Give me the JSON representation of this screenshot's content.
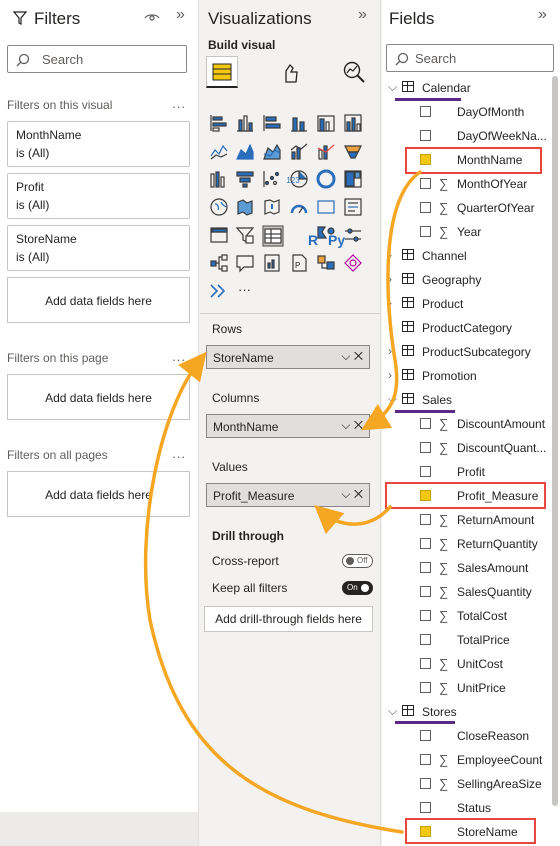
{
  "filters": {
    "title": "Filters",
    "search_placeholder": "Search",
    "on_visual_label": "Filters on this visual",
    "cards": [
      {
        "name": "MonthName",
        "state": "is (All)"
      },
      {
        "name": "Profit",
        "state": "is (All)"
      },
      {
        "name": "StoreName",
        "state": "is (All)"
      }
    ],
    "add_fields": "Add data fields here",
    "on_page_label": "Filters on this page",
    "on_all_label": "Filters on all pages",
    "more": "..."
  },
  "viz": {
    "title": "Visualizations",
    "build_visual": "Build visual",
    "rows_label": "Rows",
    "rows_value": "StoreName",
    "columns_label": "Columns",
    "columns_value": "MonthName",
    "values_label": "Values",
    "values_value": "Profit_Measure",
    "drill_label": "Drill through",
    "cross_report": "Cross-report",
    "cross_state": "Off",
    "keep_filters": "Keep all filters",
    "keep_state": "On",
    "add_drill": "Add drill-through fields here",
    "more_icon": "···",
    "r_icon": "R",
    "py_icon": "Py",
    "num_icon": "123"
  },
  "fields": {
    "title": "Fields",
    "search_placeholder": "Search",
    "rows": [
      {
        "type": "table",
        "name": "Calendar",
        "expanded": true
      },
      {
        "type": "field",
        "name": "DayOfMonth",
        "sigma": false,
        "checked": false
      },
      {
        "type": "field",
        "name": "DayOfWeekNa...",
        "sigma": false,
        "checked": false
      },
      {
        "type": "field",
        "name": "MonthName",
        "sigma": false,
        "checked": true
      },
      {
        "type": "field",
        "name": "MonthOfYear",
        "sigma": true,
        "checked": false
      },
      {
        "type": "field",
        "name": "QuarterOfYear",
        "sigma": true,
        "checked": false
      },
      {
        "type": "field",
        "name": "Year",
        "sigma": true,
        "checked": false
      },
      {
        "type": "table",
        "name": "Channel",
        "expanded": false
      },
      {
        "type": "table",
        "name": "Geography",
        "expanded": false
      },
      {
        "type": "table",
        "name": "Product",
        "expanded": false
      },
      {
        "type": "table",
        "name": "ProductCategory",
        "expanded": false
      },
      {
        "type": "table",
        "name": "ProductSubcategory",
        "expanded": false
      },
      {
        "type": "table",
        "name": "Promotion",
        "expanded": false
      },
      {
        "type": "table",
        "name": "Sales",
        "expanded": true
      },
      {
        "type": "field",
        "name": "DiscountAmount",
        "sigma": true,
        "checked": false
      },
      {
        "type": "field",
        "name": "DiscountQuant...",
        "sigma": true,
        "checked": false
      },
      {
        "type": "field",
        "name": "Profit",
        "sigma": false,
        "checked": false
      },
      {
        "type": "field",
        "name": "Profit_Measure",
        "sigma": false,
        "checked": true
      },
      {
        "type": "field",
        "name": "ReturnAmount",
        "sigma": true,
        "checked": false
      },
      {
        "type": "field",
        "name": "ReturnQuantity",
        "sigma": true,
        "checked": false
      },
      {
        "type": "field",
        "name": "SalesAmount",
        "sigma": true,
        "checked": false
      },
      {
        "type": "field",
        "name": "SalesQuantity",
        "sigma": true,
        "checked": false
      },
      {
        "type": "field",
        "name": "TotalCost",
        "sigma": true,
        "checked": false
      },
      {
        "type": "field",
        "name": "TotalPrice",
        "sigma": false,
        "checked": false
      },
      {
        "type": "field",
        "name": "UnitCost",
        "sigma": true,
        "checked": false
      },
      {
        "type": "field",
        "name": "UnitPrice",
        "sigma": true,
        "checked": false
      },
      {
        "type": "table",
        "name": "Stores",
        "expanded": true
      },
      {
        "type": "field",
        "name": "CloseReason",
        "sigma": false,
        "checked": false
      },
      {
        "type": "field",
        "name": "EmployeeCount",
        "sigma": true,
        "checked": false
      },
      {
        "type": "field",
        "name": "SellingAreaSize",
        "sigma": true,
        "checked": false
      },
      {
        "type": "field",
        "name": "Status",
        "sigma": false,
        "checked": false
      },
      {
        "type": "field",
        "name": "StoreName",
        "sigma": false,
        "checked": true
      }
    ]
  },
  "colors": {
    "accent": "#f2c811",
    "highlight": "#e8463f",
    "arrow": "#f5a623",
    "underline": "#5b2a86"
  }
}
